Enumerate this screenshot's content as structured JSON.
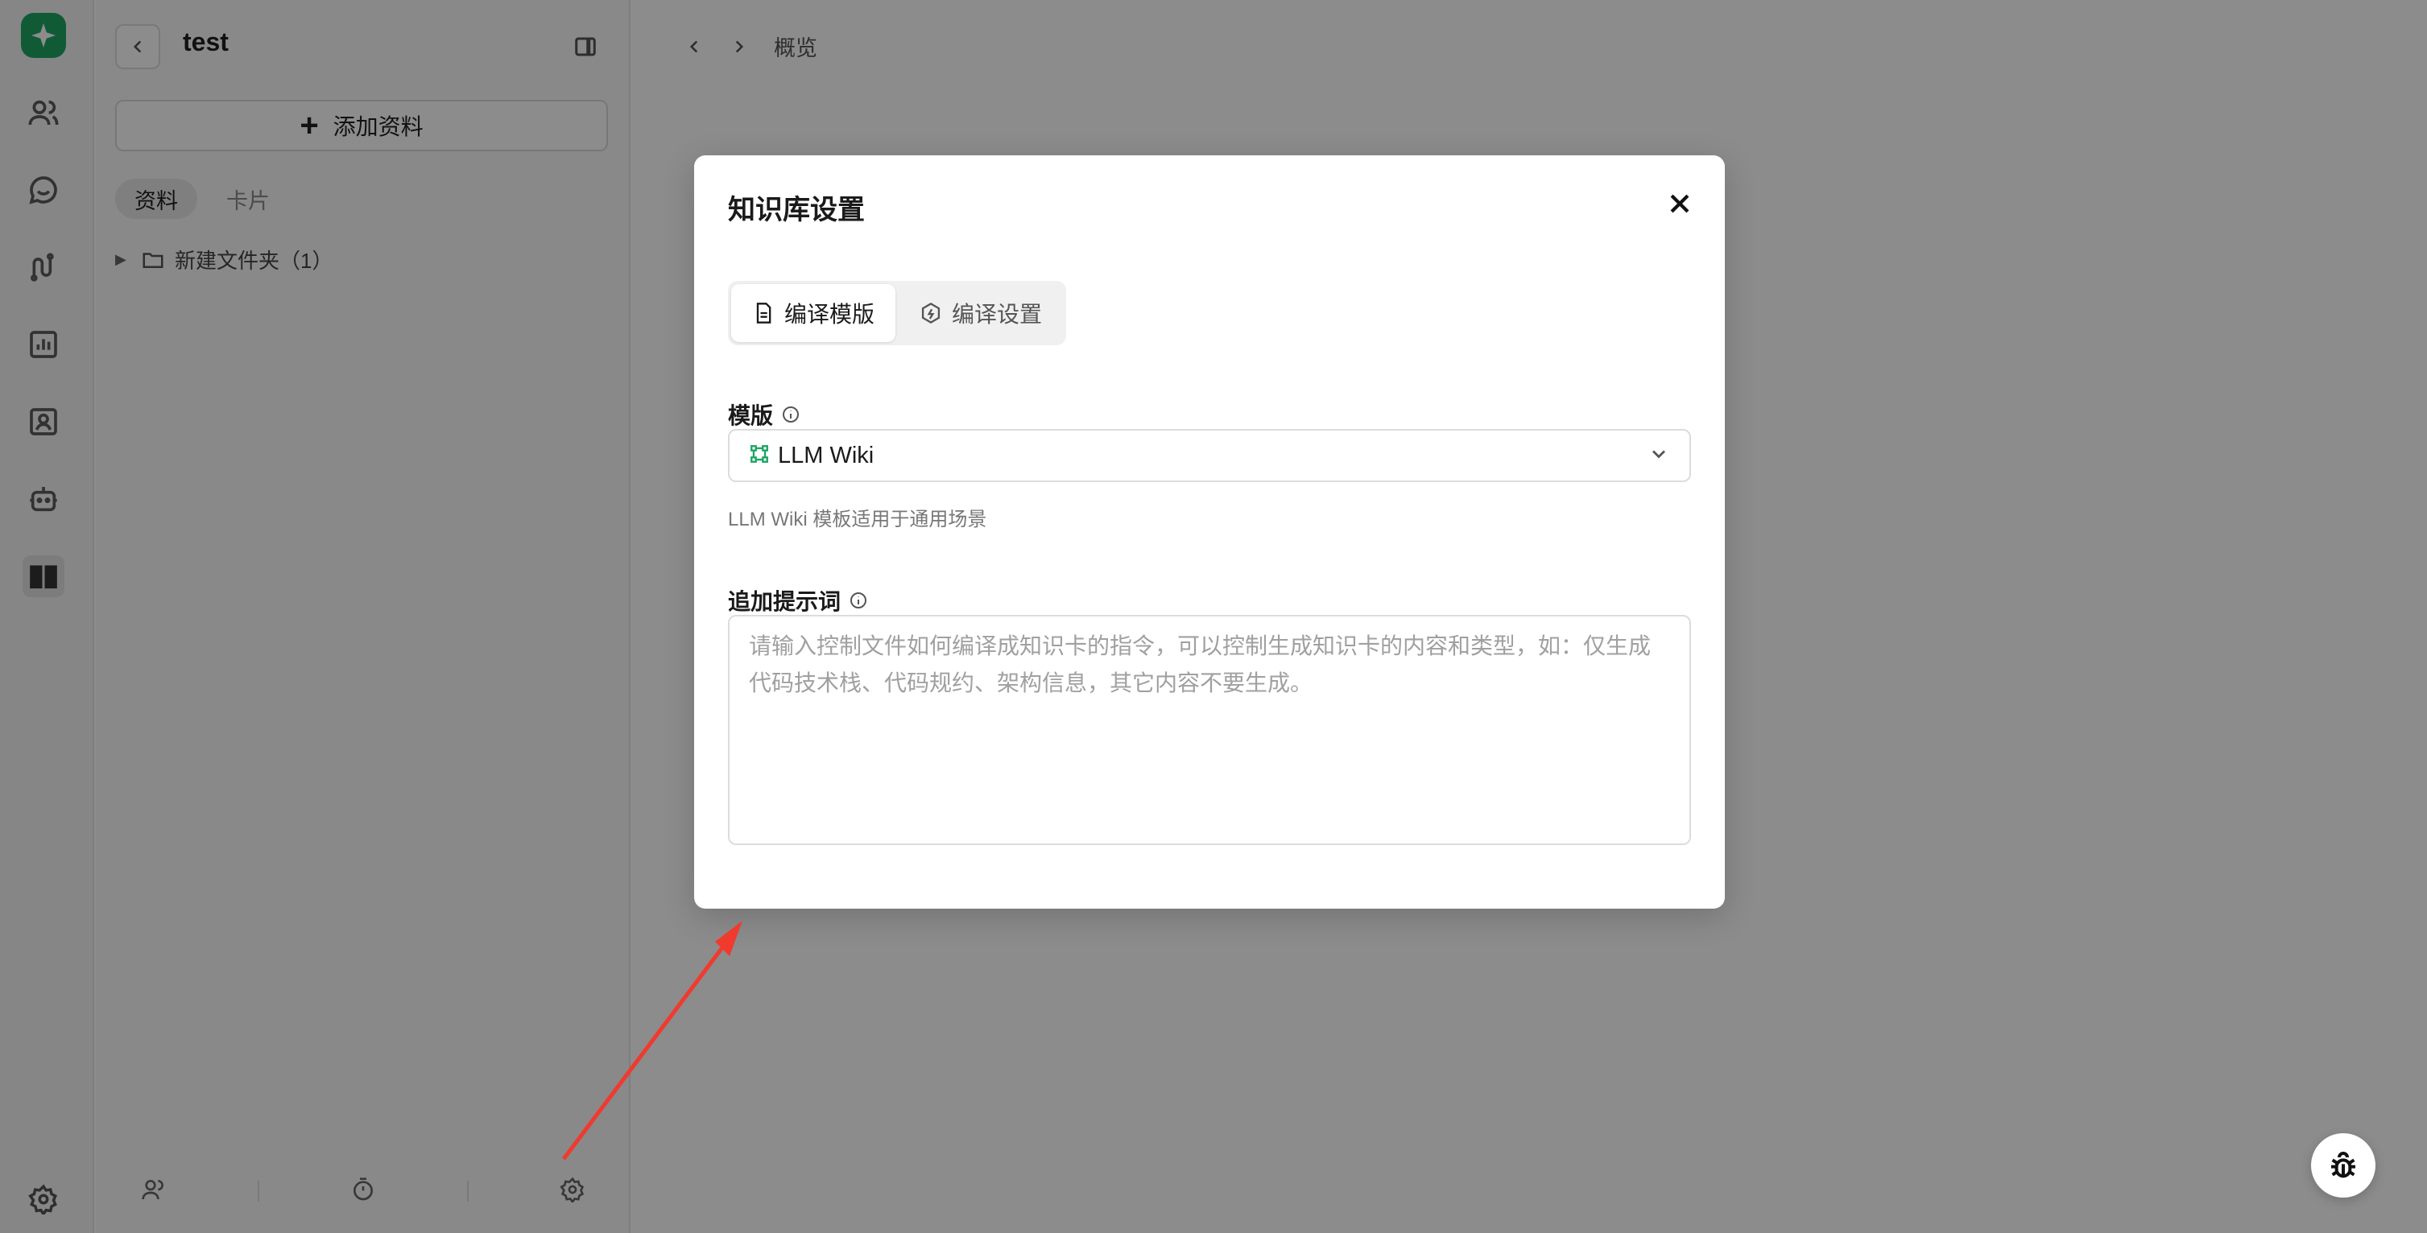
{
  "app": {
    "rail": {
      "items": [
        "logo-icon",
        "users-icon",
        "chat-icon",
        "workflow-icon",
        "chart-icon",
        "contact-card-icon",
        "robot-icon",
        "book-icon"
      ],
      "active": "book-icon",
      "settings_icon": "gear-icon"
    },
    "sidebar": {
      "title": "test",
      "add_button_label": "添加资料",
      "tabs": [
        "资料",
        "卡片"
      ],
      "active_tab": "资料",
      "tree": [
        {
          "label": "新建文件夹（1）",
          "icon": "folder-icon"
        }
      ],
      "footer_icons": [
        "members-icon",
        "timer-icon",
        "gear-icon"
      ]
    },
    "breadcrumb": {
      "current": "概览"
    }
  },
  "modal": {
    "title": "知识库设置",
    "tabs": [
      {
        "label": "编译模版",
        "icon": "document-icon",
        "active": true
      },
      {
        "label": "编译设置",
        "icon": "settings-hex-icon",
        "active": false
      }
    ],
    "template_field": {
      "label": "模版",
      "selected": "LLM Wiki",
      "helper": "LLM Wiki 模板适用于通用场景"
    },
    "prompt_field": {
      "label": "追加提示词",
      "value": "",
      "placeholder": "请输入控制文件如何编译成知识卡的指令，可以控制生成知识卡的内容和类型，如：仅生成代码技术栈、代码规约、架构信息，其它内容不要生成。"
    }
  },
  "colors": {
    "brand": "#1fa463",
    "annotation_arrow": "#f03a2e",
    "overlay": "rgba(0,0,0,0.45)"
  }
}
